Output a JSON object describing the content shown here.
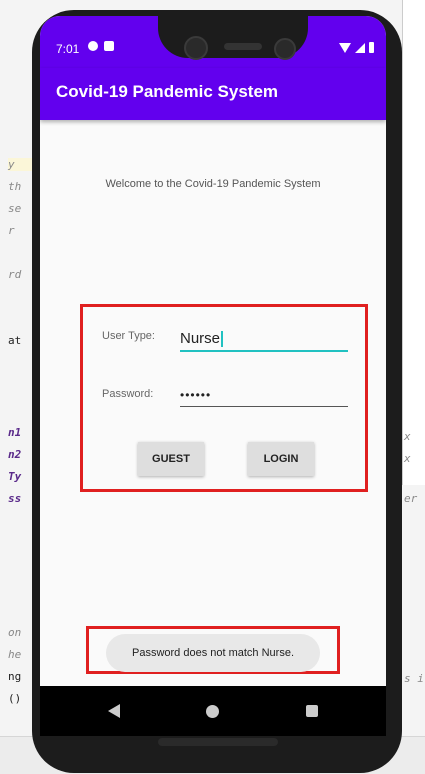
{
  "ide": {
    "fragments": [
      "y",
      "th",
      "se",
      "r",
      "rd",
      "at",
      "n1",
      "n2",
      "Ty",
      "ss",
      "on",
      "he",
      "ng",
      "()"
    ],
    "right_fragments": [
      "x",
      "x",
      "er",
      "s i"
    ]
  },
  "status_bar": {
    "time": "7:01"
  },
  "app_bar": {
    "title": "Covid-19 Pandemic System"
  },
  "welcome_text": "Welcome to the Covid-19 Pandemic System",
  "form": {
    "user_type_label": "User Type:",
    "user_type_value": "Nurse",
    "password_label": "Password:",
    "password_value": "••••••",
    "guest_button": "GUEST",
    "login_button": "LOGIN"
  },
  "toast": {
    "message": "Password does not match Nurse."
  },
  "colors": {
    "primary": "#6200ee",
    "accent": "#21c1c1",
    "highlight": "#e02020"
  }
}
